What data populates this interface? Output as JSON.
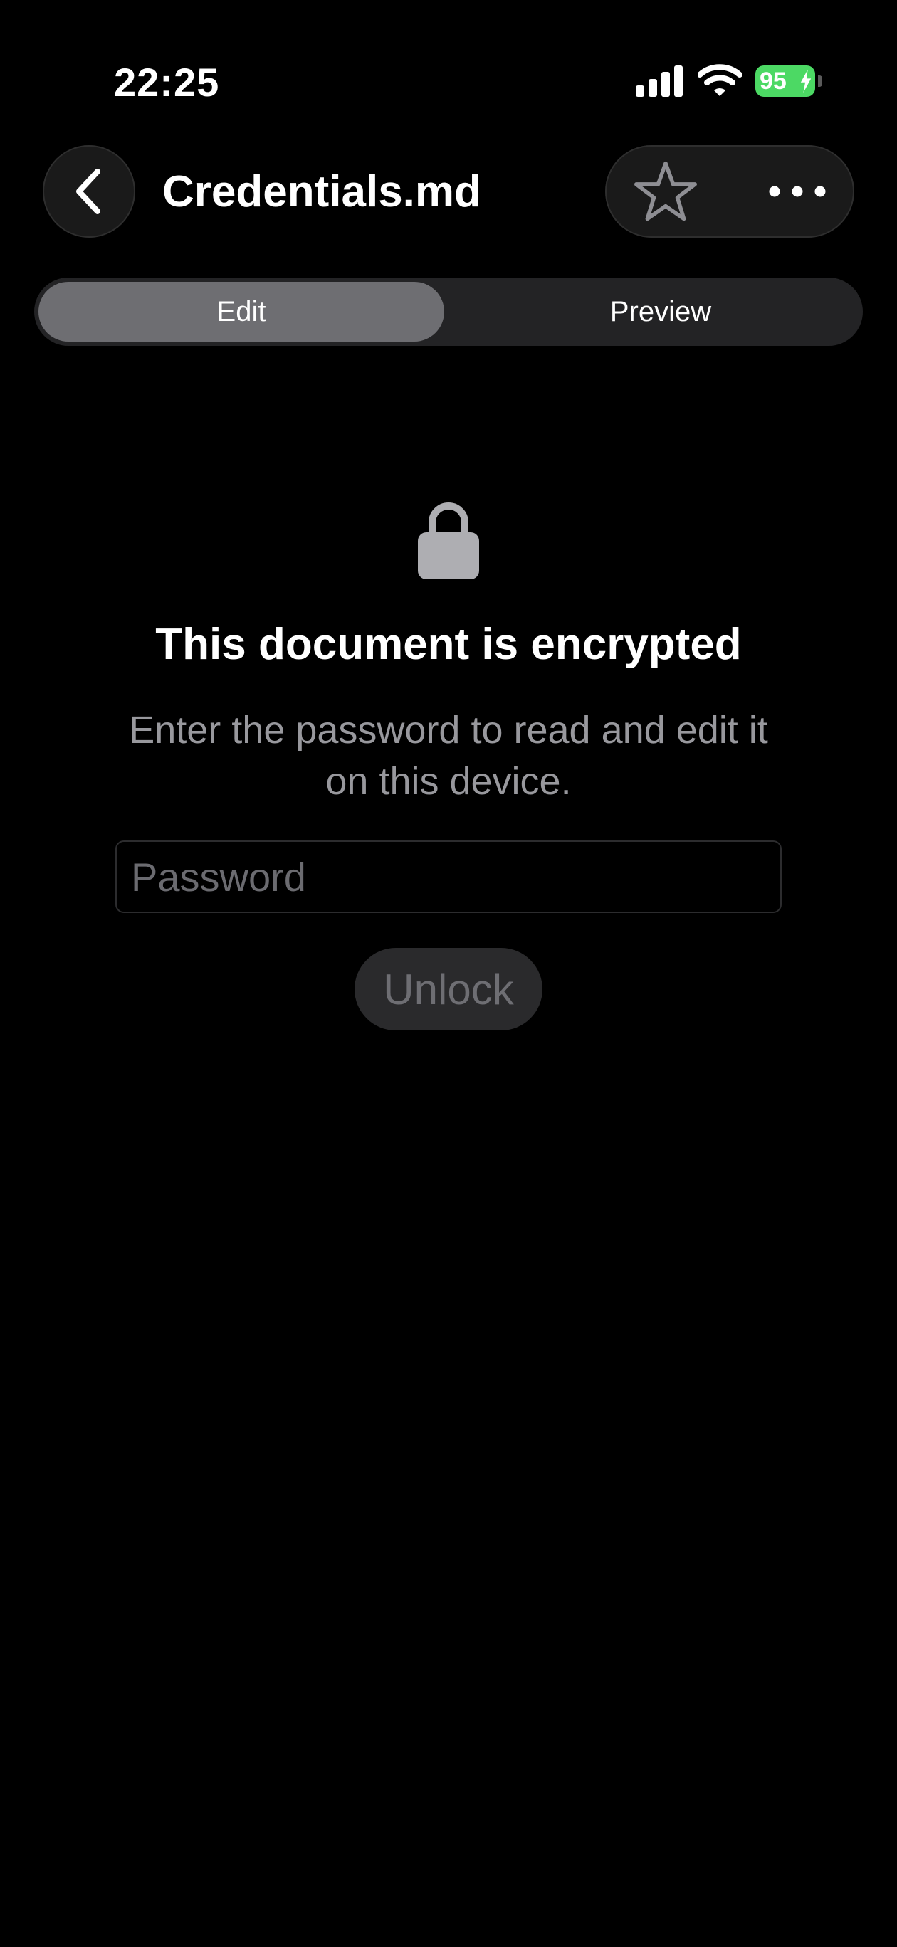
{
  "status_bar": {
    "time": "22:25",
    "battery_percent": "95",
    "battery_color": "#4cd964",
    "icons": [
      "signal-icon",
      "wifi-icon",
      "battery-icon",
      "charging-bolt-icon"
    ]
  },
  "header": {
    "title": "Credentials.md",
    "back_icon": "chevron-left-icon",
    "favorite_icon": "star-outline-icon",
    "more_icon": "ellipsis-icon"
  },
  "segmented": {
    "selected": "Edit",
    "options": [
      "Edit",
      "Preview"
    ]
  },
  "encrypted": {
    "icon": "lock-icon",
    "title": "This document is encrypted",
    "subtitle": "Enter the password to read and edit it on this device.",
    "password_placeholder": "Password",
    "password_value": "",
    "unlock_label": "Unlock"
  }
}
